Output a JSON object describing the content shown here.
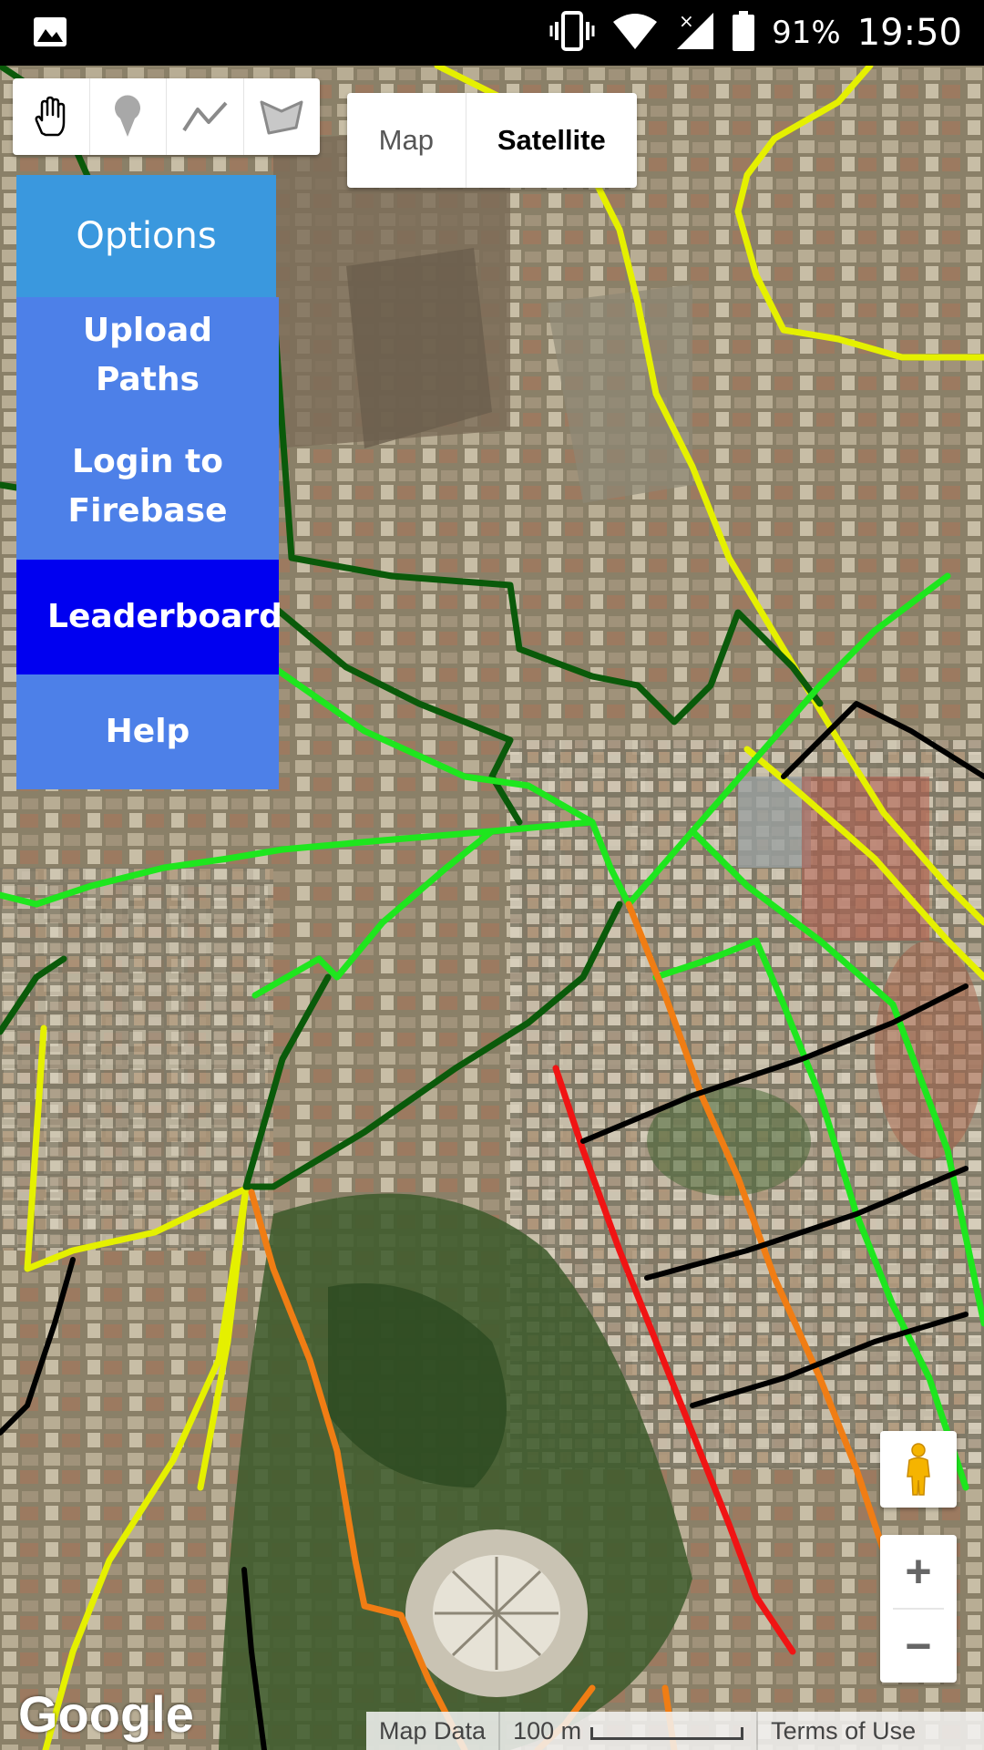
{
  "status_bar": {
    "battery_percent": "91%",
    "time": "19:50",
    "icons": [
      "gallery-icon",
      "vibrate-icon",
      "wifi-icon",
      "signal-icon",
      "battery-icon"
    ]
  },
  "draw_tools": [
    {
      "name": "hand-tool-icon"
    },
    {
      "name": "marker-tool-icon"
    },
    {
      "name": "polyline-tool-icon"
    },
    {
      "name": "polygon-tool-icon"
    }
  ],
  "map_type": {
    "map_label": "Map",
    "satellite_label": "Satellite",
    "selected": "Satellite"
  },
  "options_menu": {
    "header": "Options",
    "upload_line1": "Upload",
    "upload_line2": "Paths",
    "login_line1": "Login to",
    "login_line2": "Firebase",
    "leaderboard": "Leaderboard",
    "help": "Help"
  },
  "path_colors": {
    "yellow": "#e5f000",
    "light_green": "#1ee61e",
    "dark_green": "#0a5a0a",
    "orange": "#f07d14",
    "red": "#f01414",
    "black": "#000000"
  },
  "zoom": {
    "in_label": "+",
    "out_label": "−"
  },
  "attribution": {
    "logo": "Google",
    "map_data": "Map Data",
    "scale": "100 m",
    "terms": "Terms of Use"
  }
}
